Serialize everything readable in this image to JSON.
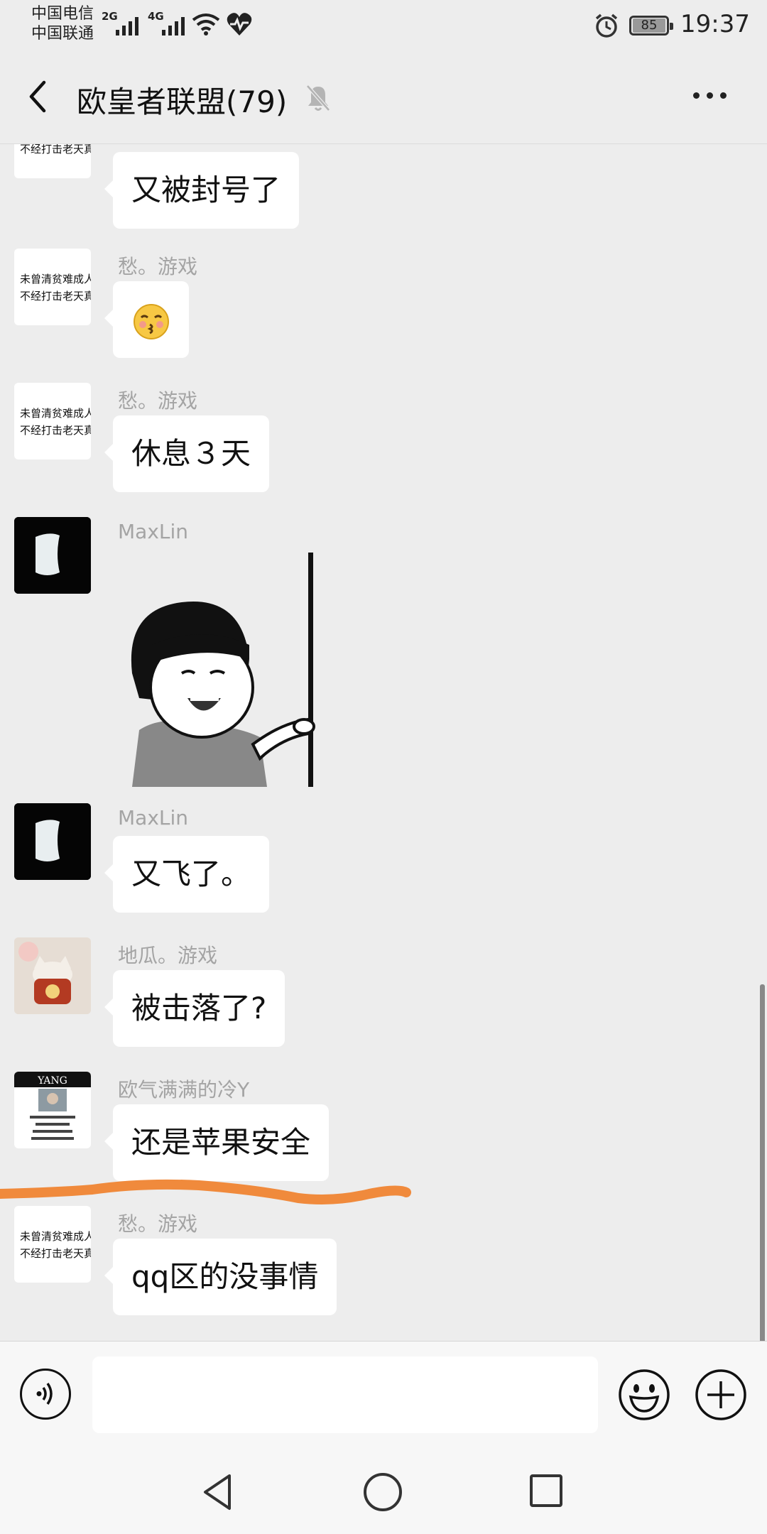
{
  "status_bar": {
    "carrier_1": "中国电信",
    "carrier_2": "中国联通",
    "network_1": "2G",
    "network_2": "4G",
    "battery": "85",
    "time": "19:37"
  },
  "header": {
    "title": "欧皇者联盟(79)"
  },
  "messages": [
    {
      "sender": "",
      "text": "又被封号了"
    },
    {
      "sender": "愁。游戏",
      "text": "😚"
    },
    {
      "sender": "愁。游戏",
      "text": "休息３天"
    },
    {
      "sender": "MaxLin",
      "text": ""
    },
    {
      "sender": "MaxLin",
      "text": "又飞了。"
    },
    {
      "sender": "地瓜。游戏",
      "text": "被击落了?"
    },
    {
      "sender": "欧气满满的冷Y",
      "text": "还是苹果安全"
    },
    {
      "sender": "愁。游戏",
      "text": "qq区的没事情"
    }
  ],
  "avatar_text": {
    "calligraphy_line_1": "未曾清贫难成人",
    "calligraphy_line_2": "不经打击老天真",
    "yang_label": "YANG"
  },
  "input": {
    "value": "",
    "placeholder": ""
  },
  "colors": {
    "background": "#ededed",
    "bubble": "#ffffff",
    "annotation": "#f08a3c"
  }
}
